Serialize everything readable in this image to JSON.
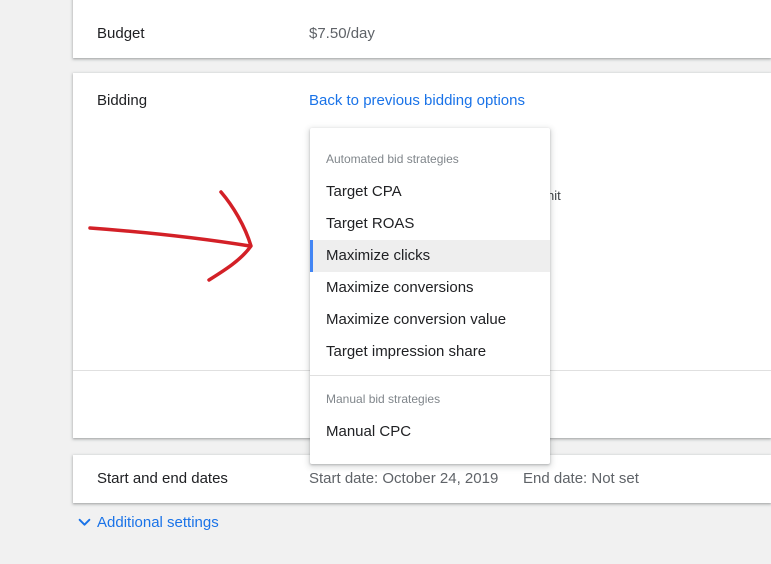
{
  "budget": {
    "label": "Budget",
    "value": "$7.50/day"
  },
  "bidding": {
    "label": "Bidding",
    "back_link": "Back to previous bidding options",
    "partial_text": "nit",
    "dropdown": {
      "groups": [
        {
          "header": "Automated bid strategies",
          "items": [
            {
              "label": "Target CPA",
              "selected": false
            },
            {
              "label": "Target ROAS",
              "selected": false
            },
            {
              "label": "Maximize clicks",
              "selected": true
            },
            {
              "label": "Maximize conversions",
              "selected": false
            },
            {
              "label": "Maximize conversion value",
              "selected": false
            },
            {
              "label": "Target impression share",
              "selected": false
            }
          ]
        },
        {
          "header": "Manual bid strategies",
          "items": [
            {
              "label": "Manual CPC",
              "selected": false
            }
          ]
        }
      ]
    }
  },
  "dates": {
    "label": "Start and end dates",
    "start": "Start date: October 24, 2019",
    "end": "End date: Not set"
  },
  "additional_settings": {
    "label": "Additional settings",
    "icon": "chevron-down-icon"
  },
  "annotation": {
    "icon": "red-arrow-annotation",
    "color": "#d32027"
  },
  "colors": {
    "link": "#1a73e8",
    "selected_bar": "#4285f4",
    "selected_bg": "#eeeeee",
    "page_bg": "#f1f1f1"
  }
}
